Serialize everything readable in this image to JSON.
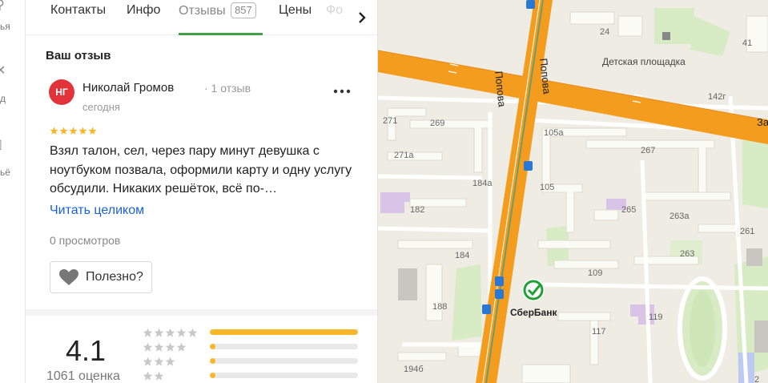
{
  "left_strip": {
    "texts": [
      "ья",
      "д",
      "ьё"
    ]
  },
  "tabs": {
    "items": [
      "Контакты",
      "Инфо",
      "Отзывы",
      "Цены",
      "Фо"
    ],
    "reviews_count": "857",
    "active": "Отзывы"
  },
  "review": {
    "section_title": "Ваш отзыв",
    "avatar_initials": "НГ",
    "author_name": "Николай Громов",
    "author_meta": "· 1 отзыв",
    "date": "сегодня",
    "stars": 5,
    "text": "Взял талон, сел, через пару минут девушка с ноутбуком позвала, оформили карту и одну услугу обсудили. Никаких решёток, всё по-…",
    "read_full": "Читать целиком",
    "views": "0 просмотров",
    "useful_label": "Полезно?"
  },
  "rating": {
    "value": "4.1",
    "count": "1061 оценка",
    "distribution": [
      {
        "stars": 5,
        "fraction": 1.0
      },
      {
        "stars": 4,
        "fraction": 0.04
      },
      {
        "stars": 3,
        "fraction": 0.04
      },
      {
        "stars": 2,
        "fraction": 0.04
      }
    ]
  },
  "map": {
    "streets": [
      "Попова",
      "Попова",
      "За"
    ],
    "poi": {
      "sberbank": "СберБанк",
      "playground": "Детская площадка"
    },
    "buildings": [
      "24",
      "41",
      "142г",
      "271",
      "269",
      "271а",
      "105а",
      "267",
      "265",
      "263а",
      "261",
      "184а",
      "182",
      "105",
      "263",
      "184",
      "109",
      "188",
      "119",
      "117",
      "194б",
      "2"
    ]
  },
  "colors": {
    "accent_green": "#43a047",
    "avatar_red": "#e2333a",
    "link_blue": "#1a62d6",
    "star_gold": "#f7b728",
    "road_orange": "#f39c1e"
  }
}
